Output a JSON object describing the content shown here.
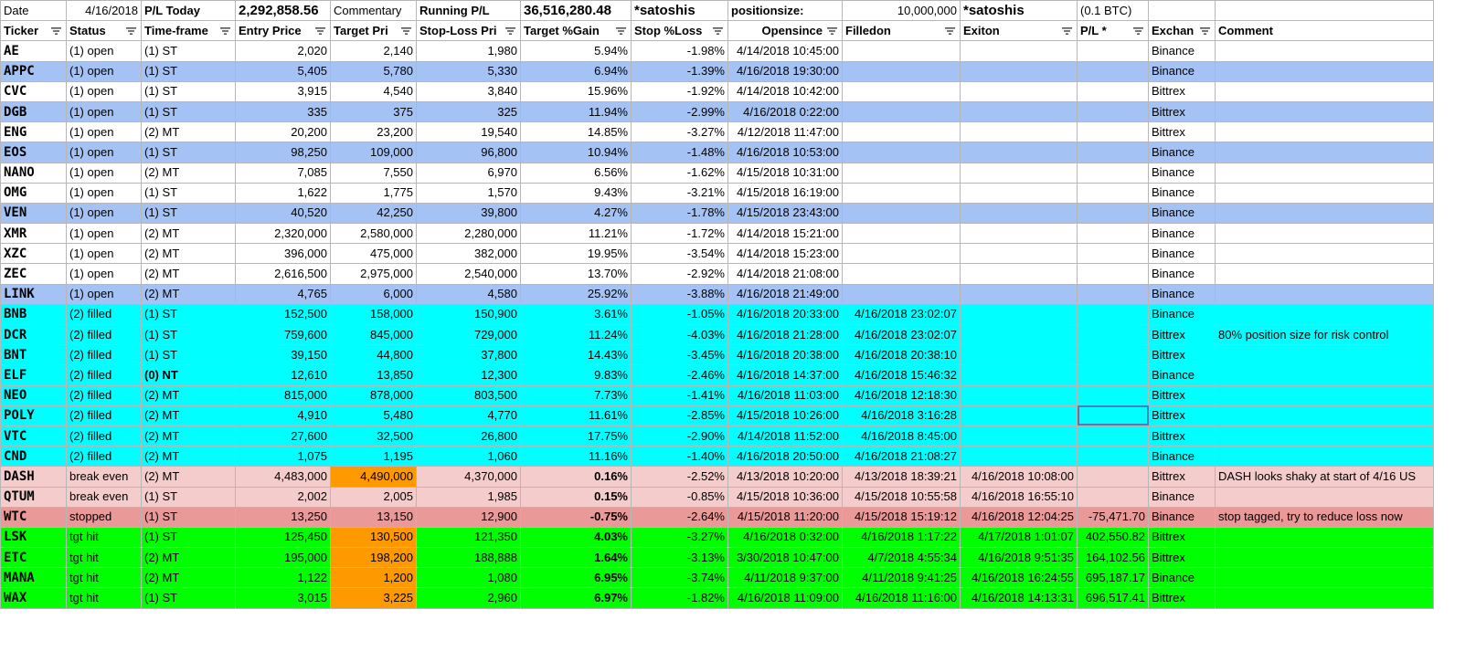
{
  "top": {
    "date_label": "Date",
    "date_value": "4/16/2018",
    "pl_today_label": "P/L Today",
    "pl_today_value": "2,292,858.56",
    "commentary_label": "Commentary",
    "running_label": "Running P/L",
    "running_value": "36,516,280.48",
    "satoshis_1": "*satoshis",
    "positionsize_label": "positionsize:",
    "positionsize_value": "10,000,000",
    "satoshis_2": "*satoshis",
    "btc_note": "(0.1 BTC)"
  },
  "headers": [
    "Ticker",
    "Status",
    "Time-frame",
    "Entry Price",
    "Target Pri",
    "Stop-Loss Pri",
    "Target %Gain",
    "Stop %Loss",
    "Opensince",
    "Filledon",
    "Exiton",
    "P/L *",
    "Exchan",
    "Comment"
  ],
  "colors": {
    "white": "#ffffff",
    "blue": "#a4c2f4",
    "cyan": "#00ffff",
    "pink": "#f4cccc",
    "red": "#ea9999",
    "green": "#00ff00",
    "orange": "#ff9900"
  },
  "rows": [
    {
      "c": "white",
      "cells": [
        "AE",
        "(1) open",
        "(1) ST",
        "2,020",
        "2,140",
        "1,980",
        "5.94%",
        "-1.98%",
        "4/14/2018 10:45:00",
        "",
        "",
        "",
        "Binance",
        ""
      ]
    },
    {
      "c": "blue",
      "cells": [
        "APPC",
        "(1) open",
        "(1) ST",
        "5,405",
        "5,780",
        "5,330",
        "6.94%",
        "-1.39%",
        "4/16/2018 19:30:00",
        "",
        "",
        "",
        "Binance",
        ""
      ]
    },
    {
      "c": "white",
      "cells": [
        "CVC",
        "(1) open",
        "(1) ST",
        "3,915",
        "4,540",
        "3,840",
        "15.96%",
        "-1.92%",
        "4/14/2018 10:42:00",
        "",
        "",
        "",
        "Bittrex",
        ""
      ]
    },
    {
      "c": "blue",
      "cells": [
        "DGB",
        "(1) open",
        "(1) ST",
        "335",
        "375",
        "325",
        "11.94%",
        "-2.99%",
        "4/16/2018 0:22:00",
        "",
        "",
        "",
        "Bittrex",
        ""
      ]
    },
    {
      "c": "white",
      "cells": [
        "ENG",
        "(1) open",
        "(2) MT",
        "20,200",
        "23,200",
        "19,540",
        "14.85%",
        "-3.27%",
        "4/12/2018 11:47:00",
        "",
        "",
        "",
        "Bittrex",
        ""
      ]
    },
    {
      "c": "blue",
      "cells": [
        "EOS",
        "(1) open",
        "(1) ST",
        "98,250",
        "109,000",
        "96,800",
        "10.94%",
        "-1.48%",
        "4/16/2018 10:53:00",
        "",
        "",
        "",
        "Binance",
        ""
      ]
    },
    {
      "c": "white",
      "cells": [
        "NANO",
        "(1) open",
        "(2) MT",
        "7,085",
        "7,550",
        "6,970",
        "6.56%",
        "-1.62%",
        "4/15/2018 10:31:00",
        "",
        "",
        "",
        "Binance",
        ""
      ]
    },
    {
      "c": "white",
      "cells": [
        "OMG",
        "(1) open",
        "(1) ST",
        "1,622",
        "1,775",
        "1,570",
        "9.43%",
        "-3.21%",
        "4/15/2018 16:19:00",
        "",
        "",
        "",
        "Binance",
        ""
      ]
    },
    {
      "c": "blue",
      "cells": [
        "VEN",
        "(1) open",
        "(1) ST",
        "40,520",
        "42,250",
        "39,800",
        "4.27%",
        "-1.78%",
        "4/15/2018 23:43:00",
        "",
        "",
        "",
        "Binance",
        ""
      ]
    },
    {
      "c": "white",
      "cells": [
        "XMR",
        "(1) open",
        "(2) MT",
        "2,320,000",
        "2,580,000",
        "2,280,000",
        "11.21%",
        "-1.72%",
        "4/14/2018 15:21:00",
        "",
        "",
        "",
        "Binance",
        ""
      ]
    },
    {
      "c": "white",
      "cells": [
        "XZC",
        "(1) open",
        "(2) MT",
        "396,000",
        "475,000",
        "382,000",
        "19.95%",
        "-3.54%",
        "4/14/2018 15:23:00",
        "",
        "",
        "",
        "Binance",
        ""
      ]
    },
    {
      "c": "white",
      "cells": [
        "ZEC",
        "(1) open",
        "(2) MT",
        "2,616,500",
        "2,975,000",
        "2,540,000",
        "13.70%",
        "-2.92%",
        "4/14/2018 21:08:00",
        "",
        "",
        "",
        "Binance",
        ""
      ]
    },
    {
      "c": "blue",
      "cells": [
        "LINK",
        "(1) open",
        "(2) MT",
        "4,765",
        "6,000",
        "4,580",
        "25.92%",
        "-3.88%",
        "4/16/2018 21:49:00",
        "",
        "",
        "",
        "Binance",
        ""
      ]
    },
    {
      "c": "cyan",
      "cells": [
        "BNB",
        "(2) filled",
        "(1) ST",
        "152,500",
        "158,000",
        "150,900",
        "3.61%",
        "-1.05%",
        "4/16/2018 20:33:00",
        "4/16/2018 23:02:07",
        "",
        "",
        "Binance",
        ""
      ]
    },
    {
      "c": "cyan",
      "cells": [
        "DCR",
        "(2) filled",
        "(1) ST",
        "759,600",
        "845,000",
        "729,000",
        "11.24%",
        "-4.03%",
        "4/16/2018 21:28:00",
        "4/16/2018 23:02:07",
        "",
        "",
        "Bittrex",
        "80% position size for risk control"
      ]
    },
    {
      "c": "cyan",
      "cells": [
        "BNT",
        "(2) filled",
        "(1) ST",
        "39,150",
        "44,800",
        "37,800",
        "14.43%",
        "-3.45%",
        "4/16/2018 20:38:00",
        "4/16/2018 20:38:10",
        "",
        "",
        "Bittrex",
        ""
      ]
    },
    {
      "c": "cyan",
      "cells": [
        "ELF",
        "(2) filled",
        "(0) NT",
        "12,610",
        "13,850",
        "12,300",
        "9.83%",
        "-2.46%",
        "4/16/2018 14:37:00",
        "4/16/2018 15:46:32",
        "",
        "",
        "Binance",
        ""
      ]
    },
    {
      "c": "cyan",
      "cells": [
        "NEO",
        "(2) filled",
        "(2) MT",
        "815,000",
        "878,000",
        "803,500",
        "7.73%",
        "-1.41%",
        "4/16/2018 11:03:00",
        "4/16/2018 12:18:30",
        "",
        "",
        "Bittrex",
        ""
      ]
    },
    {
      "c": "cyan",
      "cells": [
        "POLY",
        "(2) filled",
        "(2) MT",
        "4,910",
        "5,480",
        "4,770",
        "11.61%",
        "-2.85%",
        "4/15/2018 10:26:00",
        "4/16/2018 3:16:28",
        "",
        "",
        "Bittrex",
        ""
      ]
    },
    {
      "c": "cyan",
      "cells": [
        "VTC",
        "(2) filled",
        "(2) MT",
        "27,600",
        "32,500",
        "26,800",
        "17.75%",
        "-2.90%",
        "4/14/2018 11:52:00",
        "4/16/2018 8:45:00",
        "",
        "",
        "Bittrex",
        ""
      ]
    },
    {
      "c": "cyan",
      "cells": [
        "CND",
        "(2) filled",
        "(2) MT",
        "1,075",
        "1,195",
        "1,060",
        "11.16%",
        "-1.40%",
        "4/16/2018 20:50:00",
        "4/16/2018 21:08:27",
        "",
        "",
        "Binance",
        ""
      ]
    },
    {
      "c": "pink",
      "cells": [
        "DASH",
        "break even",
        "(2) MT",
        "4,483,000",
        "4,490,000",
        "4,370,000",
        "0.16%",
        "-2.52%",
        "4/13/2018 10:20:00",
        "4/13/2018 18:39:21",
        "4/16/2018 10:08:00",
        "",
        "Bittrex",
        "DASH looks shaky at start of 4/16 US"
      ]
    },
    {
      "c": "pink",
      "cells": [
        "QTUM",
        "break even",
        "(1) ST",
        "2,002",
        "2,005",
        "1,985",
        "0.15%",
        "-0.85%",
        "4/15/2018 10:36:00",
        "4/15/2018 10:55:58",
        "4/16/2018 16:55:10",
        "",
        "Binance",
        ""
      ]
    },
    {
      "c": "red",
      "cells": [
        "WTC",
        "stopped",
        "(1) ST",
        "13,250",
        "13,150",
        "12,900",
        "-0.75%",
        "-2.64%",
        "4/15/2018 11:20:00",
        "4/15/2018 15:19:12",
        "4/16/2018 12:04:25",
        "-75,471.70",
        "Binance",
        "stop tagged, try to reduce loss now"
      ]
    },
    {
      "c": "green",
      "cells": [
        "LSK",
        "tgt hit",
        "(1) ST",
        "125,450",
        "130,500",
        "121,350",
        "4.03%",
        "-3.27%",
        "4/16/2018 0:32:00",
        "4/16/2018 1:17:22",
        "4/17/2018 1:01:07",
        "402,550.82",
        "Bittrex",
        ""
      ]
    },
    {
      "c": "green",
      "cells": [
        "ETC",
        "tgt hit",
        "(2) MT",
        "195,000",
        "198,200",
        "188,888",
        "1.64%",
        "-3.13%",
        "3/30/2018 10:47:00",
        "4/7/2018 4:55:34",
        "4/16/2018 9:51:35",
        "164,102.56",
        "Bittrex",
        ""
      ]
    },
    {
      "c": "green",
      "cells": [
        "MANA",
        "tgt hit",
        "(2) MT",
        "1,122",
        "1,200",
        "1,080",
        "6.95%",
        "-3.74%",
        "4/11/2018 9:37:00",
        "4/11/2018 9:41:25",
        "4/16/2018 16:24:55",
        "695,187.17",
        "Binance",
        ""
      ]
    },
    {
      "c": "green",
      "cells": [
        "WAX",
        "tgt hit",
        "(1) ST",
        "3,015",
        "3,225",
        "2,960",
        "6.97%",
        "-1.82%",
        "4/16/2018 11:09:00",
        "4/16/2018 11:16:00",
        "4/16/2018 14:13:31",
        "696,517.41",
        "Bittrex",
        ""
      ]
    }
  ]
}
